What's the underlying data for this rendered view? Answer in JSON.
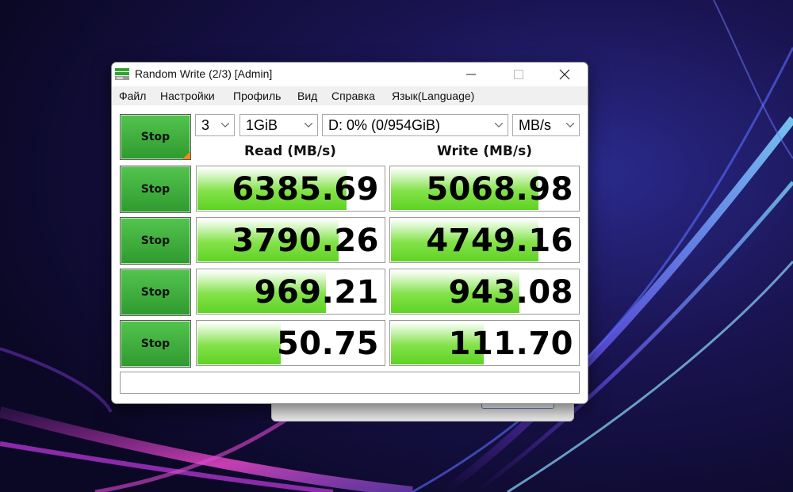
{
  "window": {
    "title": "Random Write (2/3) [Admin]",
    "icons": {
      "app": "disk-benchmark-icon",
      "minimize": "minimize-icon",
      "maximize": "maximize-icon",
      "close": "close-icon"
    }
  },
  "menu": [
    "Файл",
    "Настройки",
    "Профиль",
    "Вид",
    "Справка",
    "Язык(Language)"
  ],
  "controls": {
    "all_button": "Stop",
    "count": "3",
    "size": "1GiB",
    "drive": "D: 0% (0/954GiB)",
    "unit": "MB/s"
  },
  "headers": {
    "read": "Read (MB/s)",
    "write": "Write (MB/s)"
  },
  "rows": [
    {
      "button": "Stop",
      "read": "6385.69",
      "write": "5068.98",
      "read_fill": 0.8,
      "write_fill": 0.79
    },
    {
      "button": "Stop",
      "read": "3790.26",
      "write": "4749.16",
      "read_fill": 0.76,
      "write_fill": 0.79
    },
    {
      "button": "Stop",
      "read": "969.21",
      "write": "943.08",
      "read_fill": 0.69,
      "write_fill": 0.69
    },
    {
      "button": "Stop",
      "read": "50.75",
      "write": "111.70",
      "read_fill": 0.45,
      "write_fill": 0.5
    }
  ],
  "colors": {
    "button_green": "#3fb33c",
    "bar_green": "#6ad62f",
    "corner_orange": "#f08a1c"
  }
}
